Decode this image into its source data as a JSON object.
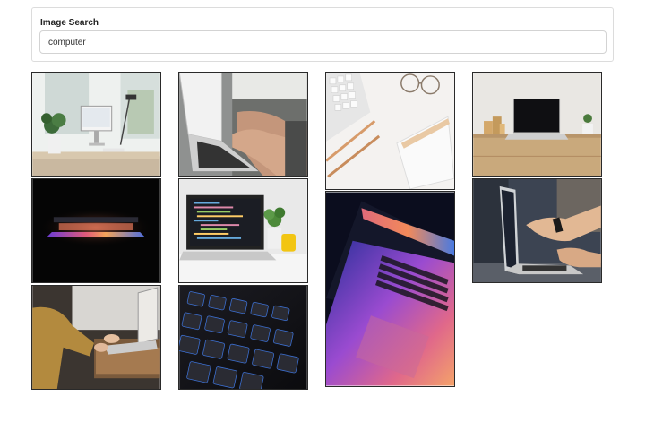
{
  "search": {
    "label": "Image Search",
    "value": "computer"
  },
  "results": [
    {
      "subject": "desk-setup-with-monitor-and-plants"
    },
    {
      "subject": "typing-on-laptop"
    },
    {
      "subject": "keyboard-pens-glasses-notebook"
    },
    {
      "subject": "laptop-on-wooden-table"
    },
    {
      "subject": "glowing-laptop-in-dark"
    },
    {
      "subject": "laptop-with-code-and-plant"
    },
    {
      "subject": "laptop-keyboard-closeup-colorful-light"
    },
    {
      "subject": "pointing-at-laptop-screen"
    },
    {
      "subject": "person-working-on-laptop"
    },
    {
      "subject": "backlit-keyboard-closeup"
    }
  ]
}
